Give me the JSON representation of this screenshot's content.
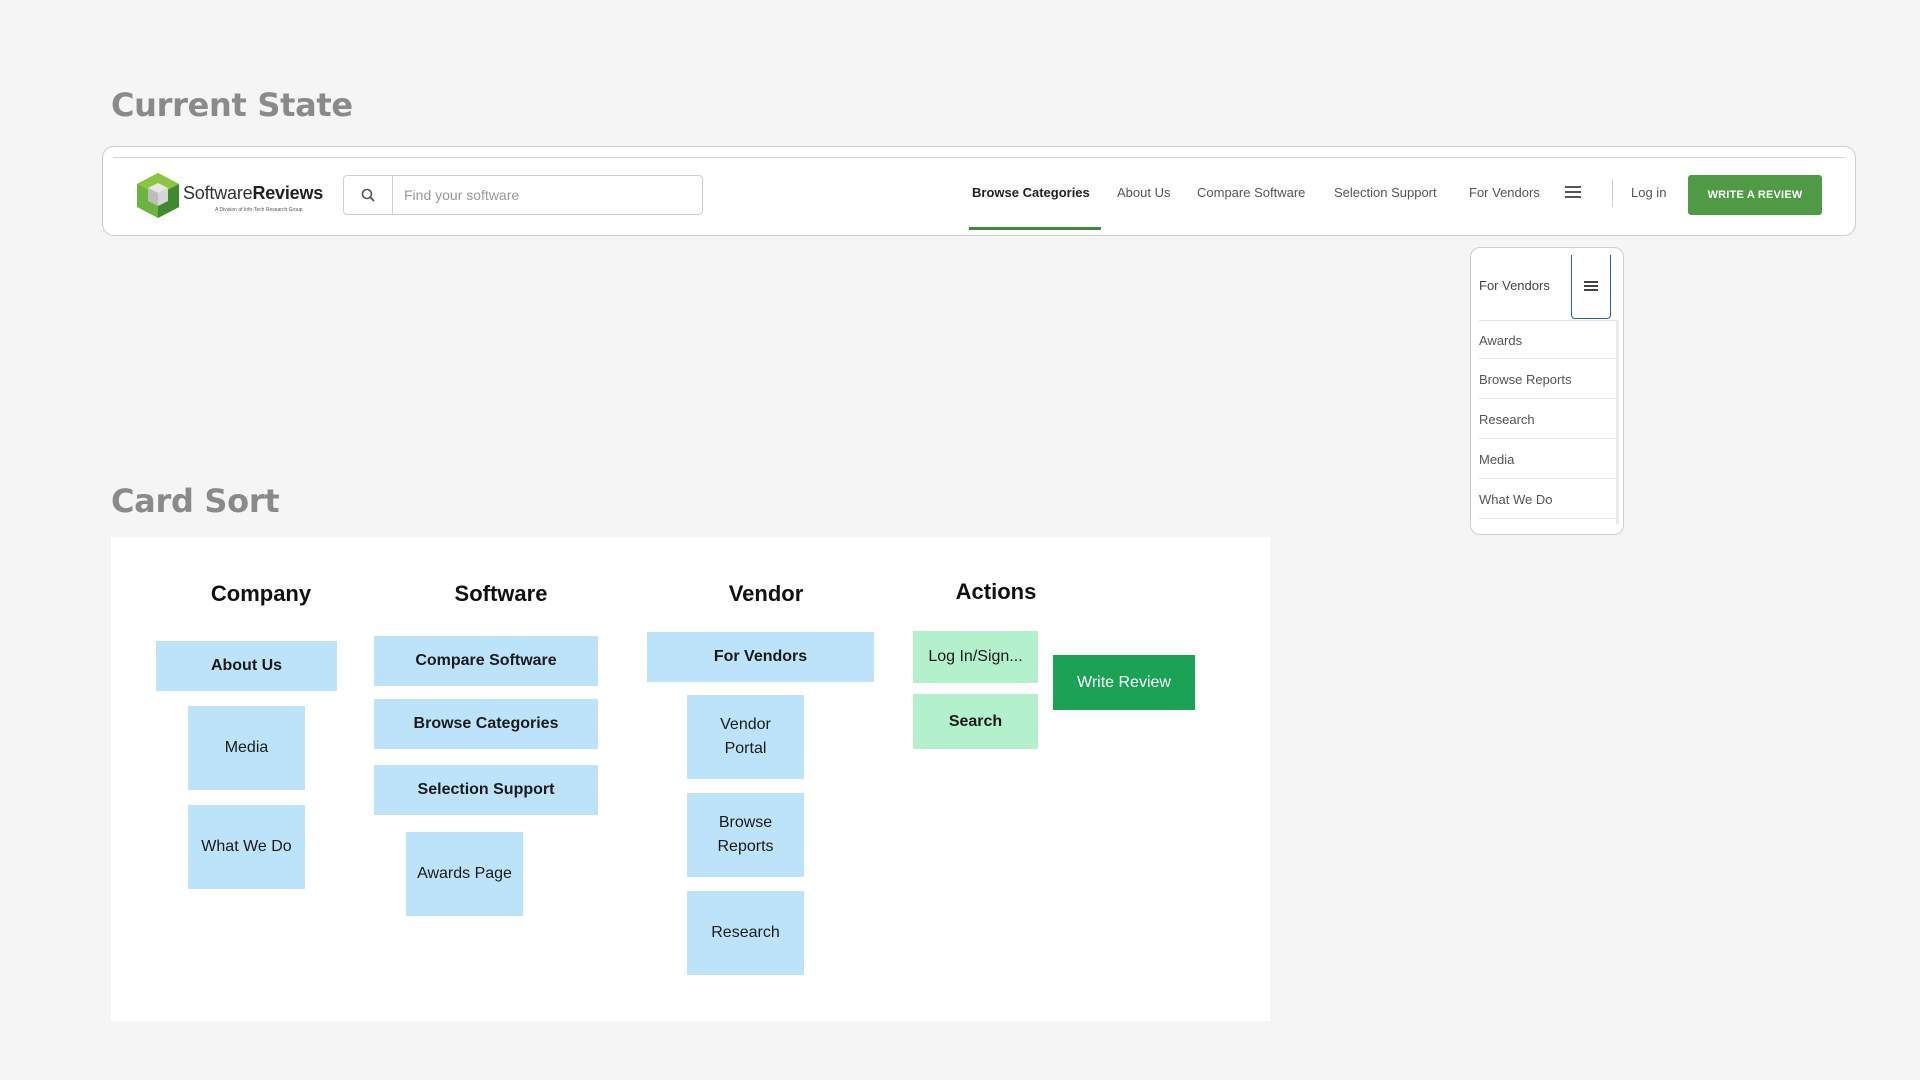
{
  "sections": {
    "current_state": "Current State",
    "card_sort": "Card Sort"
  },
  "navbar": {
    "brand_light": "Software",
    "brand_bold": "Reviews",
    "brand_tagline": "A Division of Info-Tech Research Group",
    "search_placeholder": "Find your software",
    "links": [
      "Browse Categories",
      "About Us",
      "Compare Software",
      "Selection Support",
      "For Vendors"
    ],
    "active_link": "Browse Categories",
    "login": "Log in",
    "write_review": "WRITE A REVIEW",
    "accent_color": "#4f9a45"
  },
  "dropdown": {
    "header": "For Vendors",
    "items": [
      "Awards",
      "Browse Reports",
      "Research",
      "Media",
      "What We Do"
    ]
  },
  "card_sort": {
    "columns": [
      {
        "title": "Company",
        "cards": [
          "About Us",
          "Media",
          "What We Do"
        ]
      },
      {
        "title": "Software",
        "cards": [
          "Compare Software",
          "Browse Categories",
          "Selection Support",
          "Awards Page"
        ]
      },
      {
        "title": "Vendor",
        "cards": [
          "For Vendors",
          "Vendor Portal",
          "Browse Reports",
          "Research"
        ]
      },
      {
        "title": "Actions",
        "cards": [
          "Log In/Sign...",
          "Search",
          "Write Review"
        ]
      }
    ],
    "colors": {
      "card_blue": "#bde3fb",
      "card_green": "#b3f1cc",
      "card_dark_green": "#1aa356"
    }
  }
}
